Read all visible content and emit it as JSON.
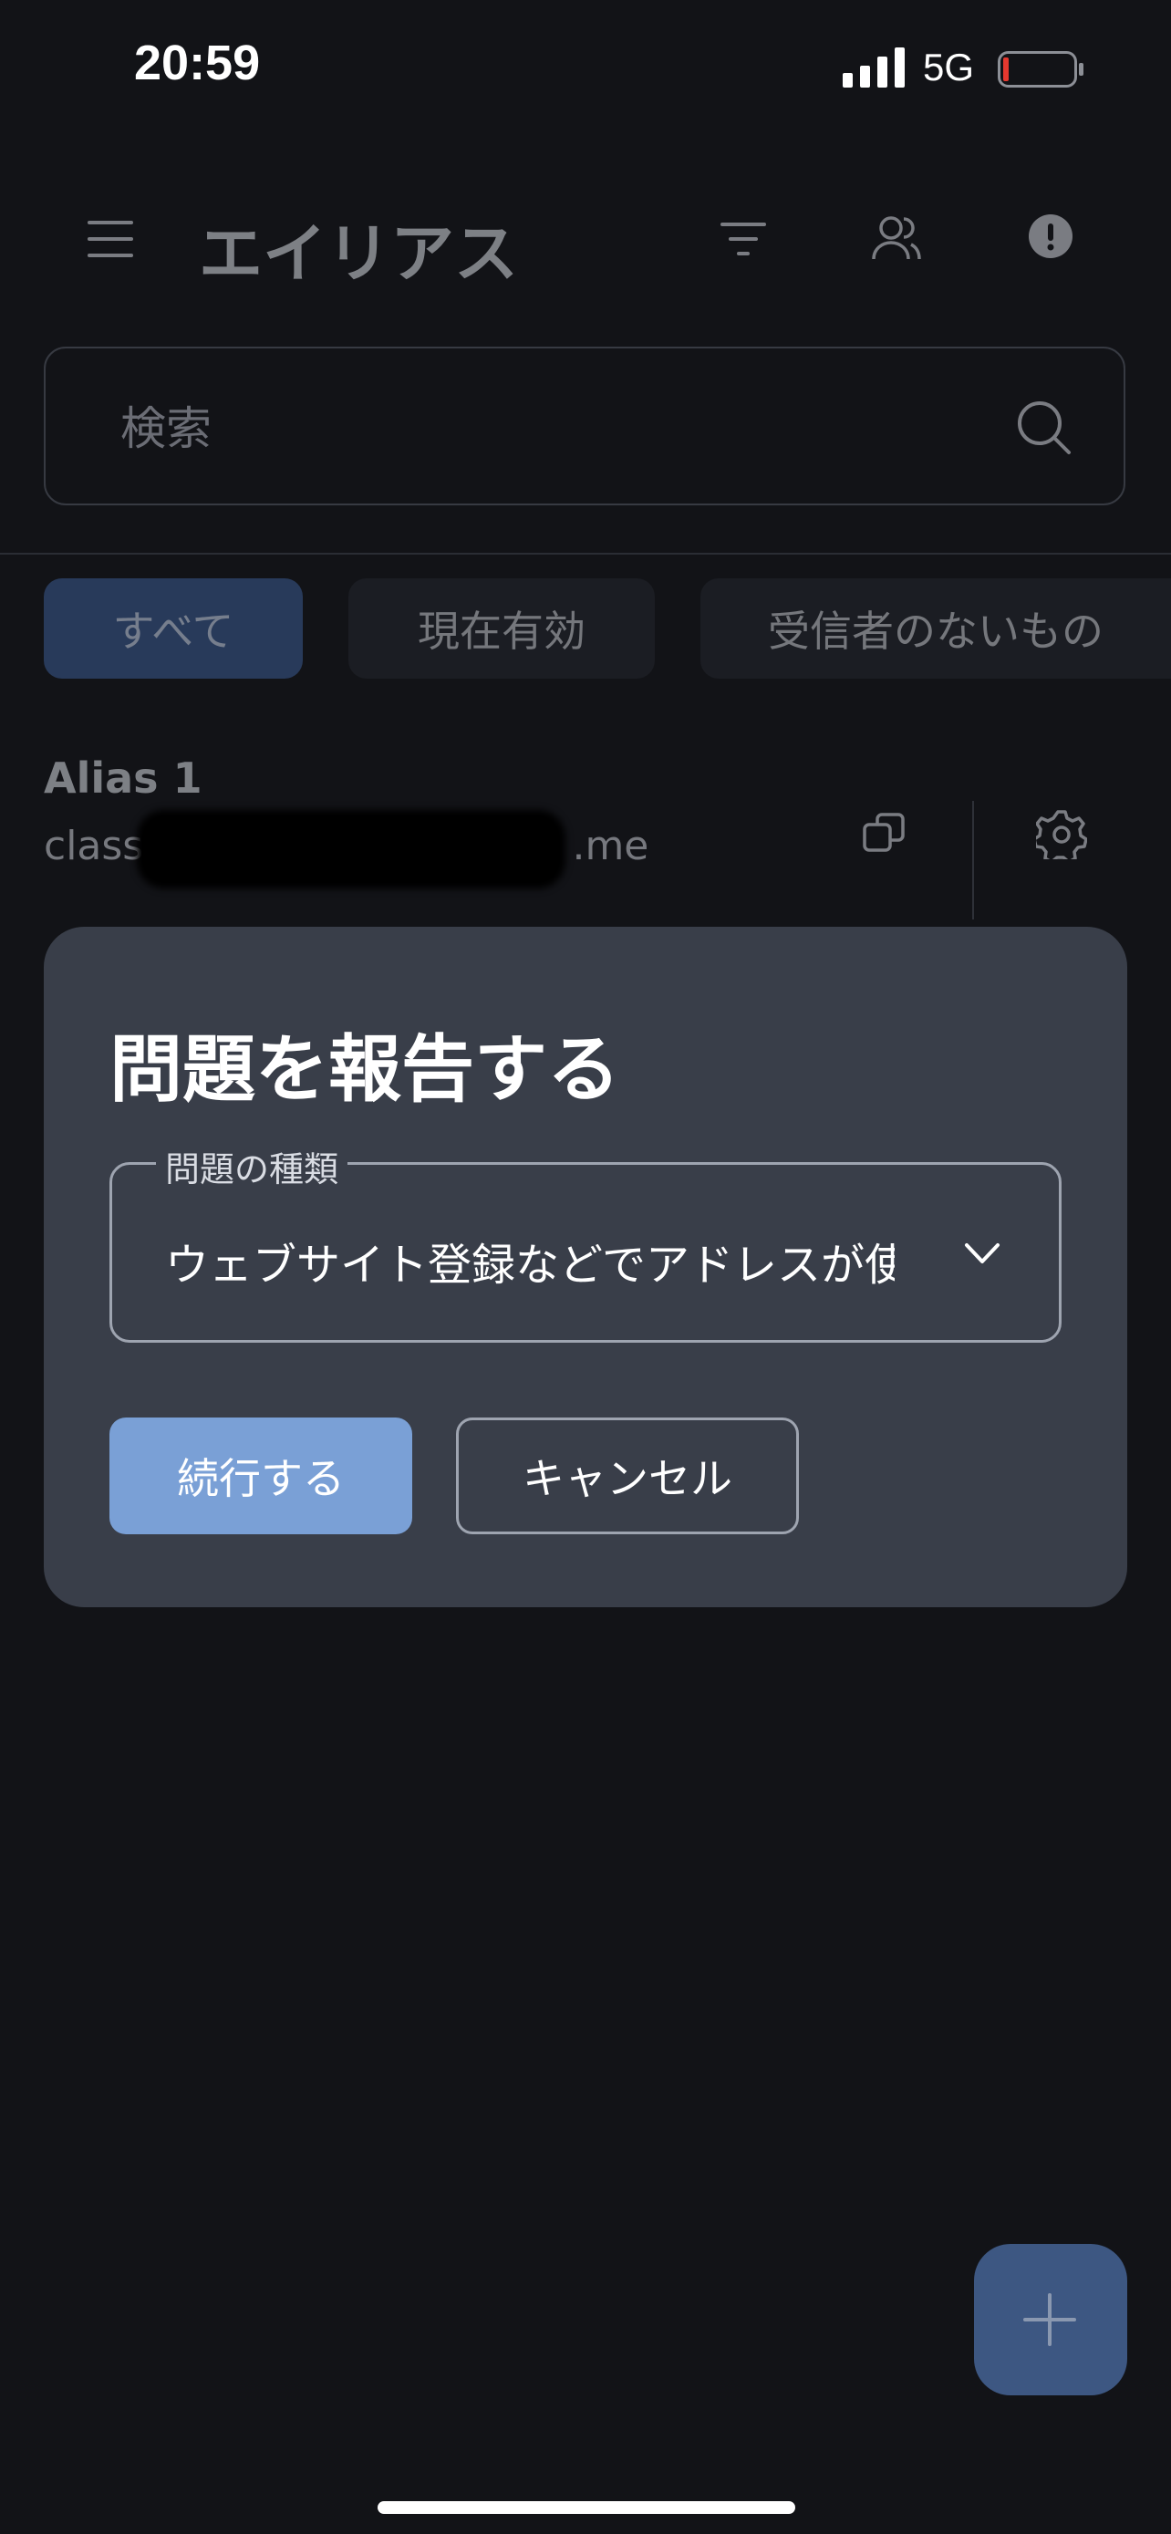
{
  "status_bar": {
    "time": "20:59",
    "network": "5G"
  },
  "app_bar": {
    "title": "エイリアス"
  },
  "search": {
    "placeholder": "検索"
  },
  "filters": {
    "all": "すべて",
    "active": "現在有効",
    "no_recipients": "受信者のないもの"
  },
  "alias": {
    "name": "Alias 1",
    "email_prefix": "classi",
    "email_suffix": ".me"
  },
  "dialog": {
    "title": "問題を報告する",
    "field_label": "問題の種類",
    "field_value": "ウェブサイト登録などでアドレスが使",
    "continue_label": "続行する",
    "cancel_label": "キャンセル"
  },
  "colors": {
    "background": "#121317",
    "dialog": "#393e49",
    "primary": "#7aa0d6",
    "chip_selected": "#3b5a92"
  }
}
